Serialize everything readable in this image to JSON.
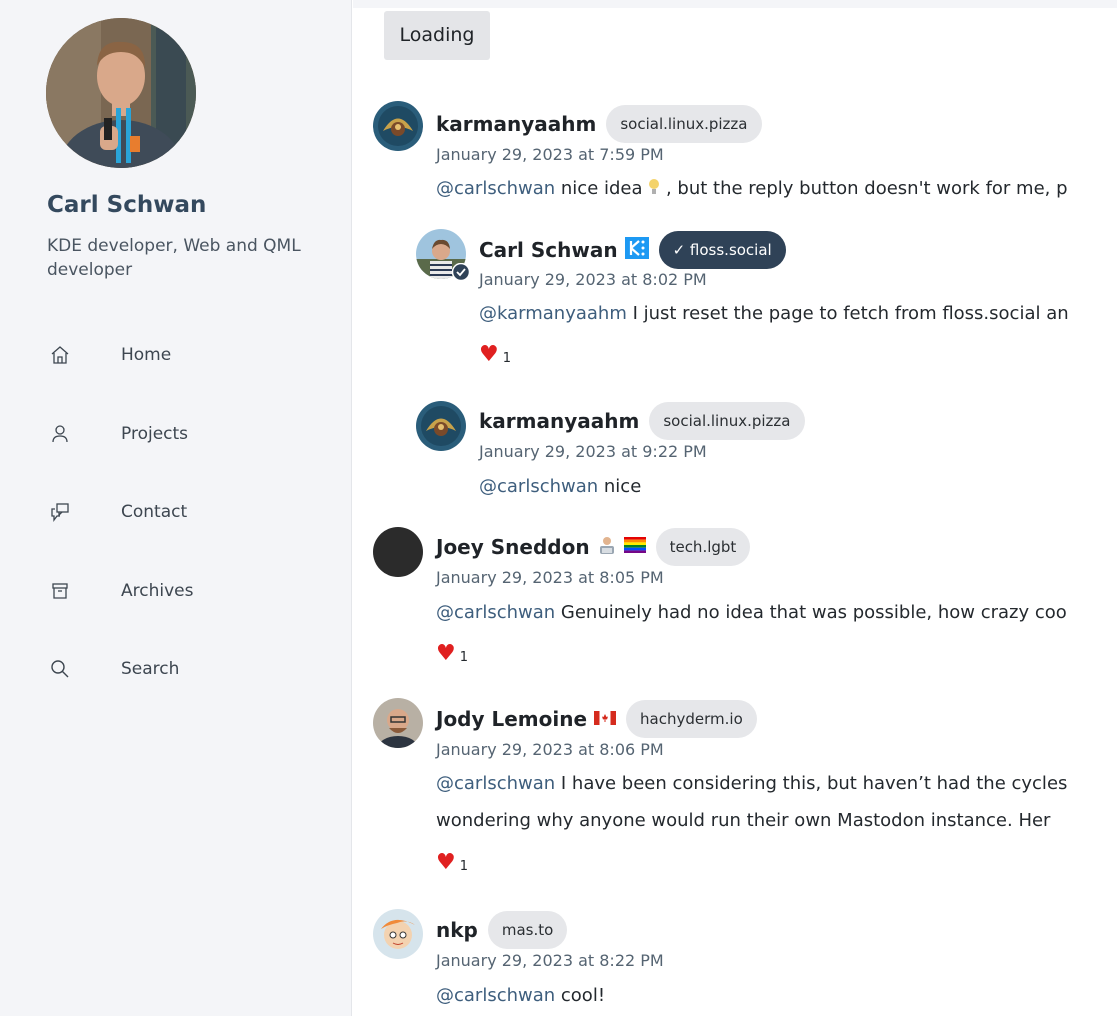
{
  "profile": {
    "name": "Carl Schwan",
    "bio": "KDE developer, Web and QML developer"
  },
  "nav": {
    "items": [
      {
        "label": "Home",
        "icon": "home-icon"
      },
      {
        "label": "Projects",
        "icon": "person-icon"
      },
      {
        "label": "Contact",
        "icon": "chat-icon"
      },
      {
        "label": "Archives",
        "icon": "archive-icon"
      },
      {
        "label": "Search",
        "icon": "search-icon"
      }
    ]
  },
  "main": {
    "loading_label": "Loading",
    "posts": [
      {
        "user": "karmanyaahm",
        "instance": "social.linux.pizza",
        "date": "January 29, 2023 at 7:59 PM",
        "mention": "@carlschwan",
        "text": " nice idea ",
        "text_after_emoji": ", but the reply button doesn't work for me, p"
      },
      {
        "user": "Carl Schwan",
        "instance": "✓ floss.social",
        "date": "January 29, 2023 at 8:02 PM",
        "mention": "@karmanyaahm",
        "text": " I just reset the page to fetch from floss.social an",
        "likes": "1"
      },
      {
        "user": "karmanyaahm",
        "instance": "social.linux.pizza",
        "date": "January 29, 2023 at 9:22 PM",
        "mention": "@carlschwan",
        "text": " nice"
      },
      {
        "user": "Joey Sneddon",
        "instance": "tech.lgbt",
        "date": "January 29, 2023 at 8:05 PM",
        "mention": "@carlschwan",
        "text": " Genuinely had no idea that was possible, how crazy coo",
        "likes": "1"
      },
      {
        "user": "Jody Lemoine",
        "instance": "hachyderm.io",
        "date": "January 29, 2023 at 8:06 PM",
        "mention": "@carlschwan",
        "text": " I have been considering this, but haven’t had the cycles",
        "text_line2": "wondering why anyone would run their own Mastodon instance. Her",
        "likes": "1"
      },
      {
        "user": "nkp",
        "instance": "mas.to",
        "date": "January 29, 2023 at 8:22 PM",
        "mention": "@carlschwan",
        "text": " cool!"
      }
    ]
  },
  "colors": {
    "sidebar_bg": "#f4f5f8",
    "profile_name": "#34495e",
    "mention": "#3e5e7d",
    "badge_bg": "#e6e7ea",
    "verified_badge_bg": "#2f4257",
    "heart": "#e02020"
  }
}
